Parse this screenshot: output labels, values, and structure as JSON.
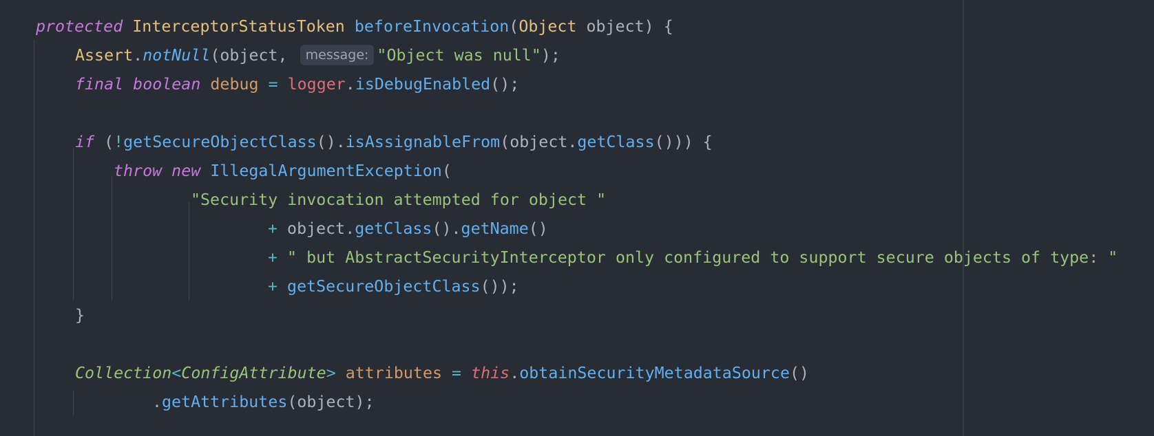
{
  "code": {
    "l1": {
      "kw_protected": "protected",
      "type_token": "InterceptorStatusToken",
      "fn_before": "beforeInvocation",
      "paren_open": "(",
      "type_object": "Object",
      "param": " object) {"
    },
    "l2": {
      "cls": "Assert",
      "dot": ".",
      "fn": "notNull",
      "args": "(object,",
      "hint": "message:",
      "str": "\"Object was null\"",
      "end": ");"
    },
    "l3": {
      "kw_final": "final",
      "kw_boolean": "boolean",
      "var": "debug",
      "eq": "=",
      "field": "logger",
      "dot": ".",
      "fn": "isDebugEnabled",
      "end": "();"
    },
    "l5": {
      "kw_if": "if",
      "open": " (",
      "not": "!",
      "fn1": "getSecureObjectClass",
      "mid1": "().",
      "fn2": "isAssignableFrom",
      "mid2": "(object.",
      "fn3": "getClass",
      "end": "())) {"
    },
    "l6": {
      "kw_throw": "throw",
      "kw_new": "new",
      "fn": "IllegalArgumentException",
      "end": "("
    },
    "l7": {
      "str": "\"Security invocation attempted for object \""
    },
    "l8": {
      "plus": "+",
      "obj": " object.",
      "fn1": "getClass",
      "mid": "().",
      "fn2": "getName",
      "end": "()"
    },
    "l9": {
      "plus": "+",
      "str": " \" but AbstractSecurityInterceptor only configured to support secure objects of type: \""
    },
    "l10": {
      "plus": "+",
      "fn": " getSecureObjectClass",
      "end": "());"
    },
    "l11": {
      "brace": "}"
    },
    "l13": {
      "type_collection": "Collection",
      "lt": "<",
      "type_config": "ConfigAttribute",
      "gt": ">",
      "var": "attributes",
      "eq": "=",
      "kw_this": "this",
      "dot": ".",
      "fn": "obtainSecurityMetadataSource",
      "end": "()"
    },
    "l14": {
      "dot": ".",
      "fn": "getAttributes",
      "end": "(object);"
    }
  },
  "colors": {
    "background": "#282c34",
    "keyword": "#c678dd",
    "type": "#e5c07b",
    "function": "#61afef",
    "string": "#98c379",
    "variable": "#d19a66",
    "field": "#e06c75",
    "operator": "#56b6c2",
    "plain": "#abb2bf"
  }
}
